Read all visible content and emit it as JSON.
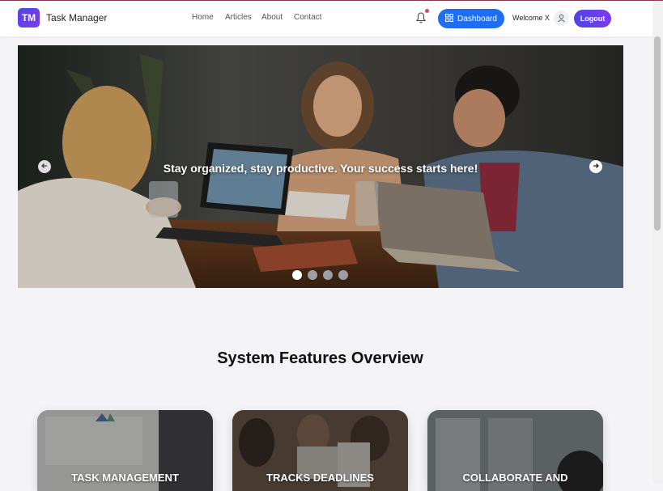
{
  "navbar": {
    "brand_badge": "TM",
    "brand_name": "Task Manager",
    "links": [
      "Home",
      "Articles",
      "About",
      "Contact"
    ],
    "dashboard_label": "Dashboard",
    "welcome_text": "Welcome X",
    "logout_label": "Logout",
    "notification_has_unread": true
  },
  "hero": {
    "caption": "Stay organized, stay productive. Your success starts here!",
    "slide_count": 4,
    "active_slide": 1
  },
  "features": {
    "title": "System Features Overview",
    "cards": [
      {
        "label": "TASK MANAGEMENT"
      },
      {
        "label": "TRACKS DEADLINES"
      },
      {
        "label": "COLLABORATE AND"
      }
    ]
  },
  "colors": {
    "primary_blue": "#1d6ef5",
    "brand_purple": "#7c3aed",
    "notification_dot": "#ef4444"
  },
  "icons": [
    "bell-icon",
    "dashboard-grid-icon",
    "user-icon",
    "arrow-left-icon",
    "arrow-right-icon"
  ]
}
